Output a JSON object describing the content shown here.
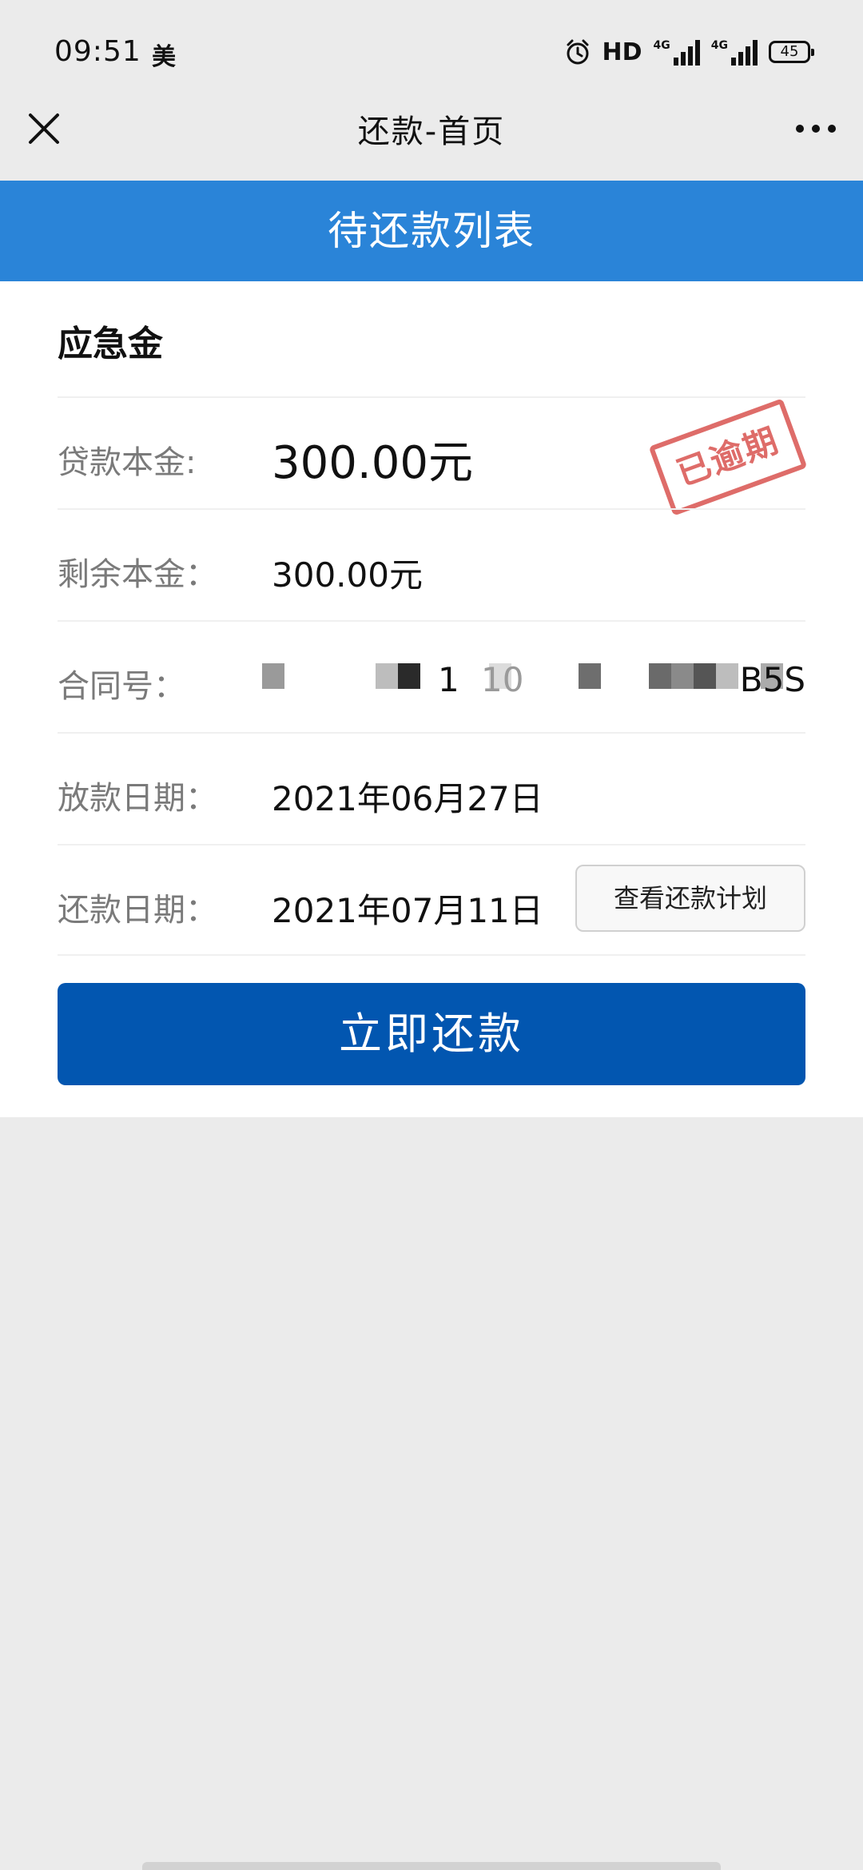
{
  "status_bar": {
    "time": "09:51",
    "carrier": "美",
    "hd_label": "HD",
    "net_label_1": "4G",
    "net_label_2": "4G",
    "battery": "45"
  },
  "nav": {
    "title": "还款-首页"
  },
  "list_header": {
    "title": "待还款列表"
  },
  "card": {
    "product_name": "应急金",
    "stamp_text": "已逾期",
    "rows": {
      "loan_principal": {
        "label": "贷款本金:",
        "value": "300.00元"
      },
      "remaining_principal": {
        "label": "剩余本金：",
        "value": "300.00元"
      },
      "contract_no": {
        "label": "合同号：",
        "visible_1": "1",
        "visible_2": "10",
        "visible_3": "B5S"
      },
      "disbursement_date": {
        "label": "放款日期：",
        "value": "2021年06月27日"
      },
      "repayment_date": {
        "label": "还款日期：",
        "value": "2021年07月11日"
      }
    },
    "plan_button_label": "查看还款计划",
    "pay_button_label": "立即还款"
  },
  "colors": {
    "header_blue": "#2a84d8",
    "button_blue": "#0256b0",
    "stamp_red": "#d9534f",
    "background": "#ebebeb"
  }
}
